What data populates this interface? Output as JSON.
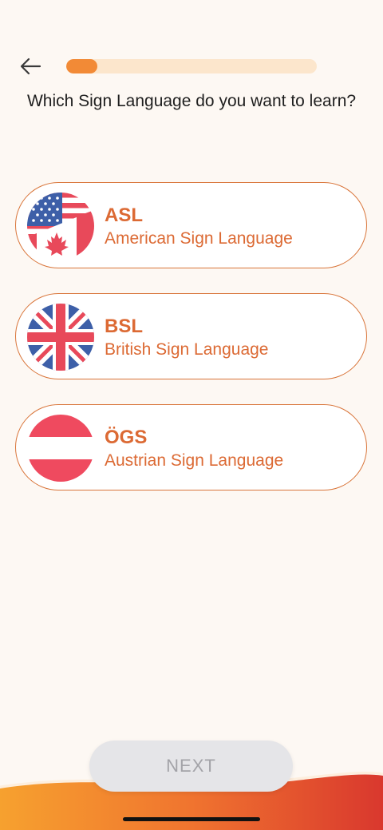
{
  "header": {
    "progress_fraction": 0.125,
    "colors": {
      "progress_fill": "#f28a36",
      "progress_track": "#fce6cc"
    }
  },
  "question": "Which Sign Language do you want to learn?",
  "options": [
    {
      "code": "ASL",
      "name": "American Sign Language",
      "flag": "usa-canada-flag-icon"
    },
    {
      "code": "BSL",
      "name": "British Sign Language",
      "flag": "uk-flag-icon"
    },
    {
      "code": "ÖGS",
      "name": "Austrian Sign Language",
      "flag": "austria-flag-icon"
    }
  ],
  "footer": {
    "next_label": "NEXT",
    "next_enabled": false
  },
  "colors": {
    "accent": "#dc6a34",
    "background": "#fdf8f3"
  }
}
